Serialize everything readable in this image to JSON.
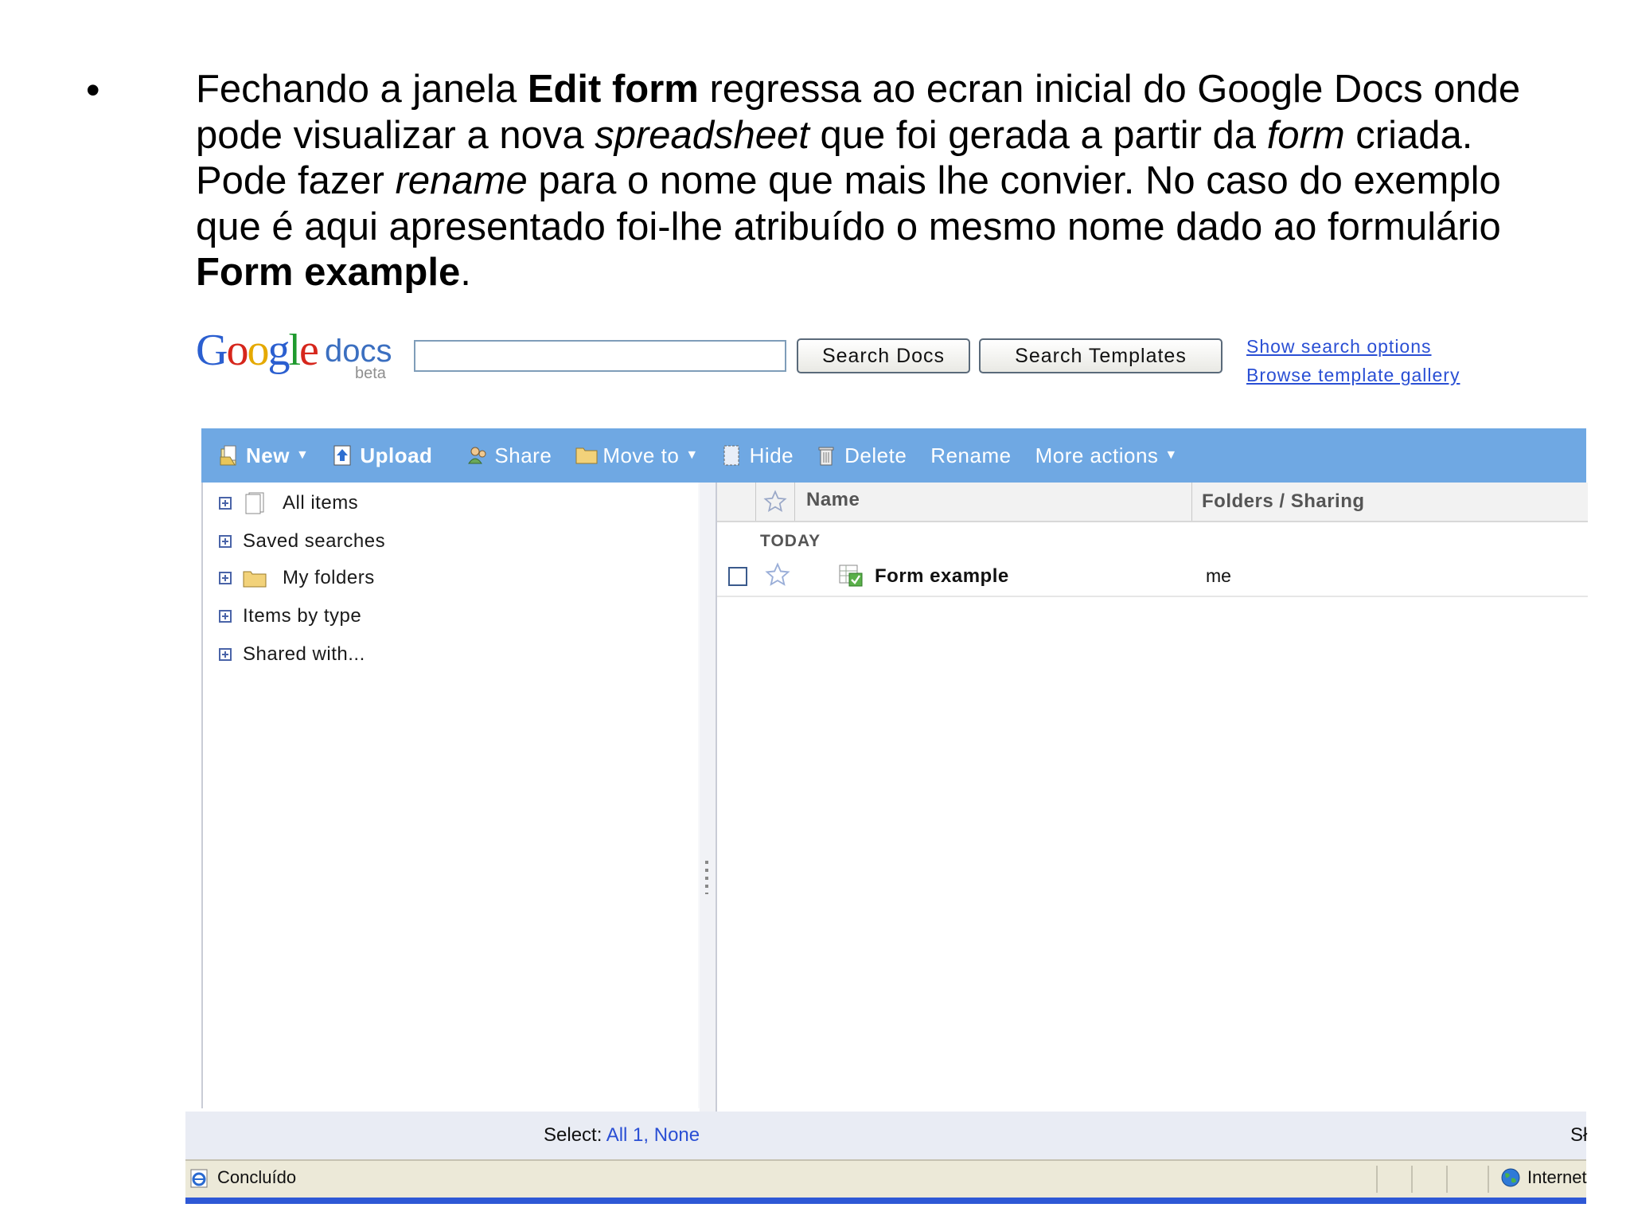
{
  "slide": {
    "bullet": "•",
    "p1": "Fechando a janela ",
    "b1": "Edit form",
    "p2": " regressa ao ecran inicial do Google Docs onde pode visualizar a nova ",
    "i1": "spreadsheet",
    "p3": " que foi gerada a partir da ",
    "i2": "form",
    "p4": " criada. Pode fazer ",
    "i3": "rename",
    "p5": " para o nome que mais lhe convier. No caso do exemplo que é aqui apresentado foi-lhe atribuído o mesmo nome dado ao formulário ",
    "b2": "Form example",
    "p6": "."
  },
  "header": {
    "logo_g1": "G",
    "logo_o1": "o",
    "logo_o2": "o",
    "logo_g2": "g",
    "logo_l": "l",
    "logo_e": "e",
    "logo_docs": "docs",
    "logo_beta": "beta",
    "search_value": "",
    "search_docs_label": "Search Docs",
    "search_templates_label": "Search Templates",
    "show_search_options": "Show search options",
    "browse_template_gallery": "Browse template gallery"
  },
  "toolbar": {
    "new_label": "New",
    "upload_label": "Upload",
    "share_label": "Share",
    "move_to_label": "Move to",
    "hide_label": "Hide",
    "delete_label": "Delete",
    "rename_label": "Rename",
    "more_actions_label": "More actions"
  },
  "sidebar": {
    "items": [
      {
        "label": "All items",
        "icon": "document-icon"
      },
      {
        "label": "Saved searches",
        "icon": ""
      },
      {
        "label": "My folders",
        "icon": "folder-icon"
      },
      {
        "label": "Items by type",
        "icon": ""
      },
      {
        "label": "Shared with...",
        "icon": ""
      }
    ]
  },
  "list": {
    "col_name": "Name",
    "col_folders": "Folders / Sharing",
    "group_today": "TODAY",
    "rows": [
      {
        "name": "Form example",
        "folders": "me",
        "icon": "spreadsheet-form-icon"
      }
    ]
  },
  "footer": {
    "select_label": "Select:",
    "all_link": "All 1",
    "comma": ",",
    "none_link": "None",
    "cut_text": "Sł"
  },
  "statusbar": {
    "status": "Concluído",
    "zone": "Internet"
  },
  "colors": {
    "toolbar_bg": "#6fa8e3",
    "link": "#2a4fd4",
    "statusbar_bg": "#ece9d8"
  }
}
